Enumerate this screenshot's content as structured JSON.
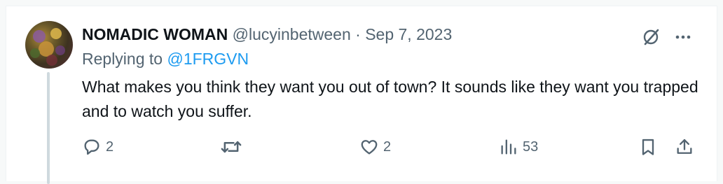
{
  "tweet": {
    "display_name": "NOMADIC WOMAN",
    "handle": "@lucyinbetween",
    "separator": "·",
    "date": "Sep 7, 2023",
    "replying_prefix": "Replying to",
    "replying_handle": "@1FRGVN",
    "text": "What makes you think they want you out of town? It sounds like they want you trapped and to watch you suffer."
  },
  "actions": {
    "replies": "2",
    "retweets": "",
    "likes": "2",
    "views": "53"
  },
  "icons": {
    "grok": "grok-slash-icon",
    "more": "more-dots-icon",
    "reply": "speech-bubble-icon",
    "retweet": "retweet-icon",
    "like": "heart-icon",
    "views": "bar-chart-icon",
    "bookmark": "bookmark-icon",
    "share": "share-upload-icon"
  },
  "colors": {
    "link": "#1d9bf0",
    "muted": "#536471",
    "text": "#0f1419",
    "thread_line": "#cfd9de"
  }
}
